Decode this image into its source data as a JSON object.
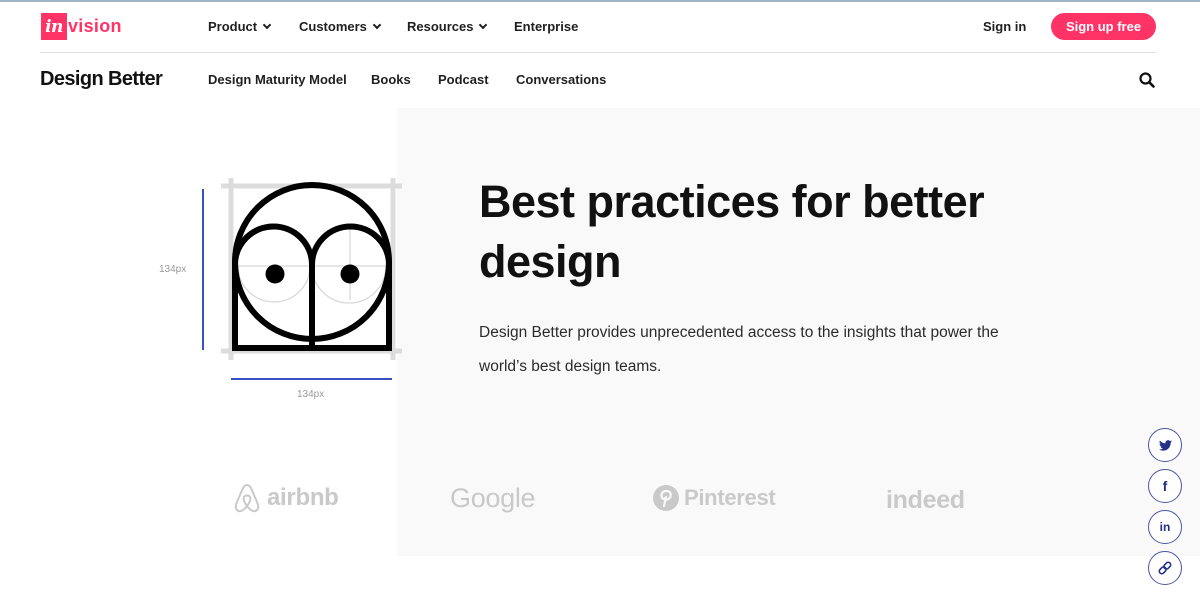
{
  "topnav": {
    "logo": {
      "in": "in",
      "vision": "vision"
    },
    "items": [
      {
        "label": "Product",
        "has_dropdown": true
      },
      {
        "label": "Customers",
        "has_dropdown": true
      },
      {
        "label": "Resources",
        "has_dropdown": true
      },
      {
        "label": "Enterprise",
        "has_dropdown": false
      }
    ],
    "signin_label": "Sign in",
    "signup_label": "Sign up free"
  },
  "subnav": {
    "brand": "Design Better",
    "items": [
      {
        "label": "Design Maturity Model"
      },
      {
        "label": "Books"
      },
      {
        "label": "Podcast"
      },
      {
        "label": "Conversations"
      }
    ],
    "search_icon": "search-icon"
  },
  "hero": {
    "title": "Best practices for better design",
    "description": "Design Better provides unprecedented access to the insights that power the world’s best design teams.",
    "illustration": {
      "height_label": "134px",
      "width_label": "134px"
    }
  },
  "logos": [
    {
      "name": "airbnb",
      "label": "airbnb"
    },
    {
      "name": "google",
      "label": "Google"
    },
    {
      "name": "pinterest",
      "label": "Pinterest"
    },
    {
      "name": "indeed",
      "label": "indeed"
    }
  ],
  "social": [
    {
      "name": "twitter",
      "icon": "twitter-icon"
    },
    {
      "name": "facebook",
      "icon": "facebook-icon",
      "glyph": "f"
    },
    {
      "name": "linkedin",
      "icon": "linkedin-icon",
      "glyph": "in"
    },
    {
      "name": "copy-link",
      "icon": "link-icon"
    }
  ],
  "colors": {
    "brand_pink": "#ff3366",
    "social_blue": "#23308a",
    "dimension_blue": "#3a4fc4",
    "panel_grey": "#f9f9f9",
    "logo_grey": "#c9c9c9"
  }
}
